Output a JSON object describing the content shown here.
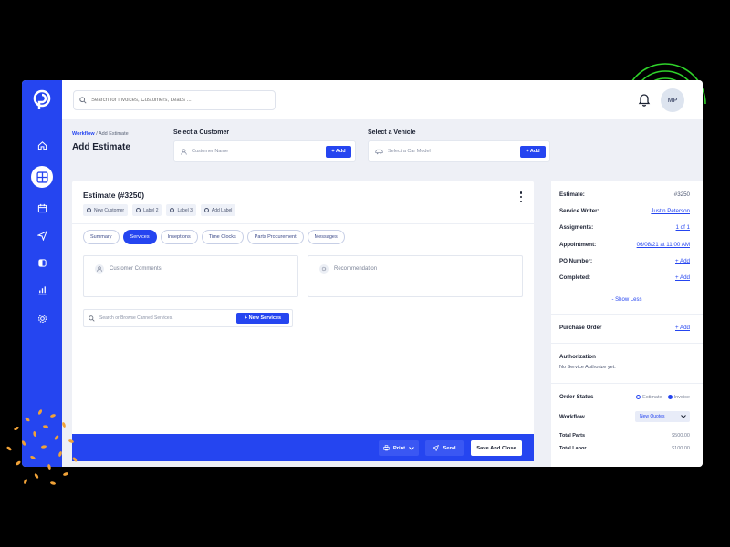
{
  "search": {
    "placeholder": "Search for invoices, Customers, Leads ..."
  },
  "user": {
    "initials": "MP"
  },
  "sidebar": {
    "items": [
      {
        "icon": "home-icon"
      },
      {
        "icon": "grid-icon",
        "active": true
      },
      {
        "icon": "calendar-icon"
      },
      {
        "icon": "send-icon"
      },
      {
        "icon": "tag-icon"
      },
      {
        "icon": "chart-icon"
      },
      {
        "icon": "gear-icon"
      }
    ]
  },
  "breadcrumb": {
    "root": "Workflow",
    "separator": "/",
    "current": "Add Estimate"
  },
  "page": {
    "title": "Add Estimate"
  },
  "customer": {
    "label": "Select a Customer",
    "placeholder": "Customer Name",
    "add": "+ Add"
  },
  "vehicle": {
    "label": "Select a Vehicle",
    "placeholder": "Select a Car Model",
    "add": "+ Add"
  },
  "estimate": {
    "title": "Estimate (#3250)",
    "labels": [
      "New Customer",
      "Label 2",
      "Label 3",
      "Add Label"
    ],
    "tabs": [
      "Summary",
      "Services",
      "Inseptions",
      "Time Clocks",
      "Parts Procurement",
      "Messages"
    ],
    "active_tab": "Services",
    "customer_comments": "Customer Comments",
    "recommendation": "Recommendation",
    "service_search_placeholder": "Search or Browse Canned Services.",
    "new_services": "+ New Services"
  },
  "footer": {
    "print": "Print",
    "send": "Send",
    "save_close": "Save And Close"
  },
  "panel": {
    "estimate": {
      "label": "Estimate:",
      "value": "#3250"
    },
    "service_writer": {
      "label": "Service Writer:",
      "value": "Justin Peterson"
    },
    "assignments": {
      "label": "Assigments:",
      "value": "1 of 1"
    },
    "appointment": {
      "label": "Appointment:",
      "value": "06/08/21 at 11:00 AM"
    },
    "po_number": {
      "label": "PO Number:",
      "value": "+ Add"
    },
    "completed": {
      "label": "Completed:",
      "value": "+ Add"
    },
    "show_less": "- Show  Less",
    "purchase_order": {
      "label": "Purchase Order",
      "value": "+ Add"
    },
    "authorization": {
      "title": "Authorization",
      "text": "No Service Authorize yet."
    },
    "order_status": {
      "label": "Order Status",
      "options": [
        "Estimate",
        "Invoice"
      ],
      "selected": "Invoice"
    },
    "workflow": {
      "label": "Workflow",
      "value": "New Quotes"
    },
    "total_parts": {
      "label": "Total Parts",
      "value": "$500.00"
    },
    "total_labor": {
      "label": "Total Labor",
      "value": "$100.00"
    }
  },
  "colors": {
    "accent": "#2545f0",
    "background": "#eef0f6",
    "ring": "#2fd32a",
    "dots": "#f0a238"
  }
}
